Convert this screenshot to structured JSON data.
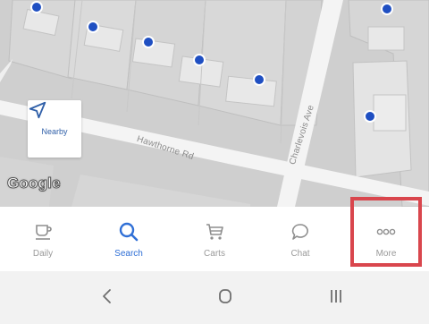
{
  "map": {
    "streets": {
      "hawthorne": "Hawthorne Rd",
      "charlevois": "Charlevois Ave"
    },
    "nearby_label": "Nearby",
    "logo_text": "Google",
    "pin_color": "#1f4fc2"
  },
  "tabs": [
    {
      "id": "daily",
      "label": "Daily",
      "icon": "cup-icon",
      "active": false
    },
    {
      "id": "search",
      "label": "Search",
      "icon": "search-icon",
      "active": true
    },
    {
      "id": "carts",
      "label": "Carts",
      "icon": "cart-icon",
      "active": false
    },
    {
      "id": "chat",
      "label": "Chat",
      "icon": "chat-bubble-icon",
      "active": false
    },
    {
      "id": "more",
      "label": "More",
      "icon": "more-dots-icon",
      "active": false
    }
  ],
  "colors": {
    "accent": "#2f6fd6",
    "inactive": "#9a9a9a",
    "highlight": "#d9464d"
  },
  "system_nav": {
    "back": "back-chevron-icon",
    "home": "home-circle-icon",
    "recents": "recents-bars-icon"
  }
}
